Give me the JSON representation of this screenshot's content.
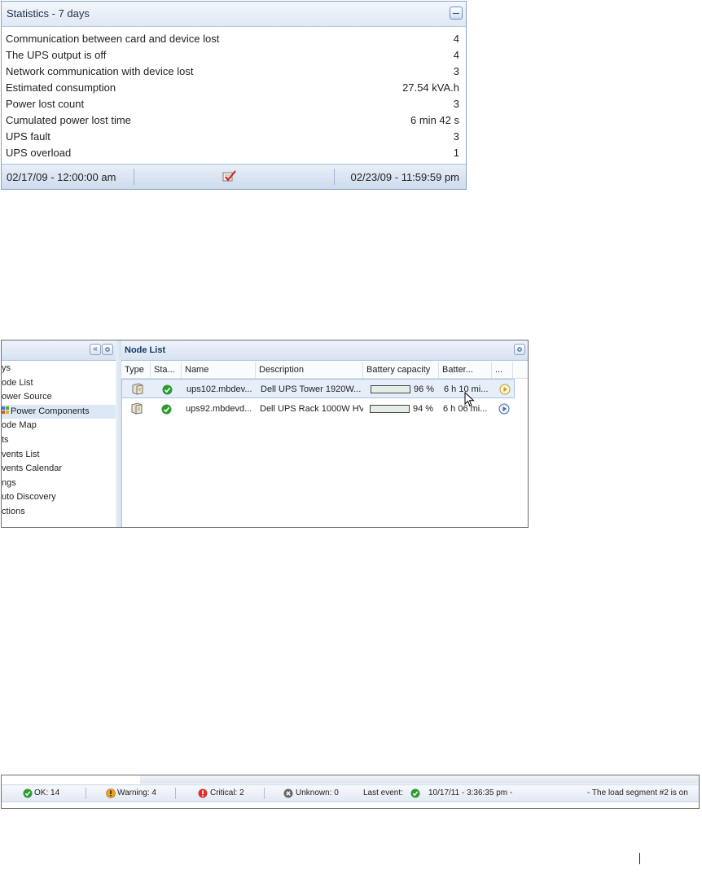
{
  "stats": {
    "title": "Statistics - 7 days",
    "rows": [
      {
        "label": "Communication between card and device lost",
        "value": "4"
      },
      {
        "label": "The UPS output is off",
        "value": "4"
      },
      {
        "label": "Network communication with device lost",
        "value": "3"
      },
      {
        "label": "Estimated consumption",
        "value": "27.54 kVA.h"
      },
      {
        "label": "Power lost count",
        "value": "3"
      },
      {
        "label": "Cumulated power lost time",
        "value": "6 min 42 s"
      },
      {
        "label": "UPS fault",
        "value": "3"
      },
      {
        "label": "UPS overload",
        "value": "1"
      }
    ],
    "date_start": "02/17/09 - 12:00:00 am",
    "date_end": "02/23/09 - 11:59:59 pm"
  },
  "nav": {
    "items": [
      {
        "label": "ys"
      },
      {
        "label": "ode List"
      },
      {
        "label": "ower Source"
      },
      {
        "label": "Power Components"
      },
      {
        "label": "ode Map"
      },
      {
        "label": "ts"
      },
      {
        "label": "vents List"
      },
      {
        "label": "vents Calendar"
      },
      {
        "label": "ngs"
      },
      {
        "label": "uto Discovery"
      },
      {
        "label": "ctions"
      }
    ],
    "collapse_glyph": "«"
  },
  "node_list": {
    "title": "Node List",
    "columns": [
      "Type",
      "Sta...",
      "Name",
      "Description",
      "Battery capacity",
      "Batter...",
      "..."
    ],
    "rows": [
      {
        "name": "ups102.mbdev...",
        "description": "Dell UPS Tower 1920W...",
        "battery_pct": "96 %",
        "battery_fill": 0.96,
        "runtime": "6 h 10 mi..."
      },
      {
        "name": "ups92.mbdevd...",
        "description": "Dell UPS Rack 1000W HV",
        "battery_pct": "94 %",
        "battery_fill": 0.94,
        "runtime": "6 h 06 mi..."
      }
    ]
  },
  "statusbar": {
    "ok": "OK: 14",
    "warning": "Warning: 4",
    "critical": "Critical: 2",
    "unknown": "Unknown: 0",
    "last_event_label": "Last event:",
    "last_event_time": "10/17/11 - 3:36:35 pm -",
    "last_event_text": "- The load segment #2 is on"
  },
  "colors": {
    "ok": "#2e9a2e",
    "warning": "#f0a020",
    "critical": "#d8322a",
    "unknown": "#666666",
    "accent": "#17375e"
  }
}
